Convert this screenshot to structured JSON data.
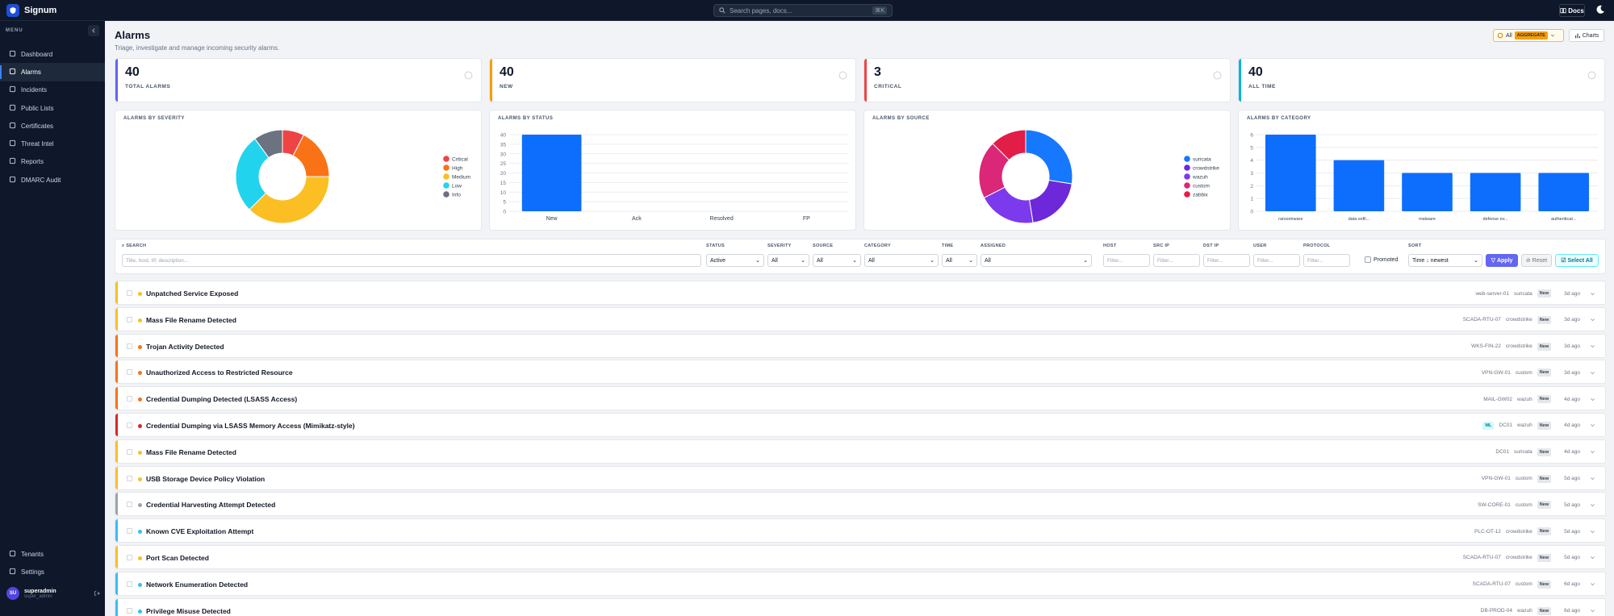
{
  "app": {
    "brand": "Signum",
    "search_placeholder": "Search pages, docs...",
    "search_kbd": "⌘K",
    "docs_label": "Docs"
  },
  "sidebar": {
    "menu_label": "MENU",
    "items": [
      {
        "label": "Dashboard",
        "icon": "dashboard-icon",
        "active": false
      },
      {
        "label": "Alarms",
        "icon": "alarm-icon",
        "active": true
      },
      {
        "label": "Incidents",
        "icon": "incident-icon",
        "active": false
      },
      {
        "label": "Public Lists",
        "icon": "list-icon",
        "active": false
      },
      {
        "label": "Certificates",
        "icon": "certificate-icon",
        "active": false
      },
      {
        "label": "Threat Intel",
        "icon": "threat-icon",
        "active": false
      },
      {
        "label": "Reports",
        "icon": "report-icon",
        "active": false
      },
      {
        "label": "DMARC Audit",
        "icon": "mail-icon",
        "active": false
      }
    ],
    "bottom_items": [
      {
        "label": "Tenants",
        "icon": "tenants-icon"
      },
      {
        "label": "Settings",
        "icon": "settings-icon"
      }
    ],
    "user": {
      "initials": "SU",
      "name": "superadmin",
      "role": "super_admin"
    }
  },
  "page": {
    "title": "Alarms",
    "subtitle": "Triage, investigate and manage incoming security alarms.",
    "agg_all": "All",
    "agg_badge": "AGGREGATE",
    "charts_label": "Charts"
  },
  "stats": [
    {
      "value": "40",
      "label": "TOTAL ALARMS",
      "color": "#6366f1"
    },
    {
      "value": "40",
      "label": "NEW",
      "color": "#f59e0b"
    },
    {
      "value": "3",
      "label": "CRITICAL",
      "color": "#ef4444"
    },
    {
      "value": "40",
      "label": "ALL TIME",
      "color": "#06b6d4"
    }
  ],
  "chart_data": [
    {
      "type": "pie",
      "title": "ALARMS BY SEVERITY",
      "labels": [
        "Critical",
        "High",
        "Medium",
        "Low",
        "Info"
      ],
      "values": [
        3,
        7,
        15,
        11,
        4
      ],
      "colors": [
        "#ef4444",
        "#f97316",
        "#fbbf24",
        "#22d3ee",
        "#6b7280"
      ],
      "donut": true,
      "legend": "right"
    },
    {
      "type": "bar",
      "title": "ALARMS BY STATUS",
      "categories": [
        "New",
        "Ack",
        "Resolved",
        "FP"
      ],
      "values": [
        40,
        0,
        0,
        0
      ],
      "ylim": [
        0,
        40
      ],
      "yticks": [
        0,
        5,
        10,
        15,
        20,
        25,
        30,
        35,
        40
      ],
      "color": "#0d6efd",
      "grid": true
    },
    {
      "type": "pie",
      "title": "ALARMS BY SOURCE",
      "labels": [
        "suricata",
        "crowdstrike",
        "wazuh",
        "custom",
        "zabbix"
      ],
      "values": [
        11,
        8,
        8,
        8,
        5
      ],
      "colors": [
        "#1677ff",
        "#6d28d9",
        "#7c3aed",
        "#db2777",
        "#e11d48"
      ],
      "donut": true,
      "legend": "right"
    },
    {
      "type": "bar",
      "title": "ALARMS BY CATEGORY",
      "categories": [
        "ransomware",
        "data exfil...",
        "malware",
        "defense ev...",
        "authenticat..."
      ],
      "values": [
        6,
        4,
        3,
        3,
        3
      ],
      "ylim": [
        0,
        6
      ],
      "yticks": [
        0,
        1,
        2,
        3,
        4,
        5,
        6
      ],
      "color": "#0d6efd",
      "grid": true
    }
  ],
  "filters": {
    "search_label": "SEARCH",
    "search_placeholder": "Title, host, IP, description...",
    "status_label": "STATUS",
    "status_value": "Active",
    "severity_label": "SEVERITY",
    "severity_value": "All",
    "source_label": "SOURCE",
    "source_value": "All",
    "category_label": "CATEGORY",
    "category_value": "All",
    "time_label": "TIME",
    "time_value": "All",
    "assigned_label": "ASSIGNED",
    "assigned_value": "All",
    "host_label": "HOST",
    "src_ip_label": "SRC IP",
    "dst_ip_label": "DST IP",
    "user_label": "USER",
    "protocol_label": "PROTOCOL",
    "filter_placeholder": "Filter...",
    "promoted_label": "Promoted",
    "sort_label": "SORT",
    "sort_value": "Time ↓ newest",
    "apply_label": "Apply",
    "reset_label": "Reset",
    "select_all_label": "Select All"
  },
  "severity_colors": {
    "critical": "#dc2626",
    "high": "#f97316",
    "medium": "#fbbf24",
    "low": "#38bdf8",
    "info": "#9ca3af"
  },
  "alarms": [
    {
      "title": "Unpatched Service Exposed",
      "severity": "medium",
      "host": "web-server-01",
      "source": "suricata",
      "status": "New",
      "age": "3d ago",
      "ml": false
    },
    {
      "title": "Mass File Rename Detected",
      "severity": "medium",
      "host": "SCADA-RTU-07",
      "source": "crowdstrike",
      "status": "New",
      "age": "3d ago",
      "ml": false
    },
    {
      "title": "Trojan Activity Detected",
      "severity": "high",
      "host": "WKS-FIN-22",
      "source": "crowdstrike",
      "status": "New",
      "age": "3d ago",
      "ml": false
    },
    {
      "title": "Unauthorized Access to Restricted Resource",
      "severity": "high",
      "host": "VPN-GW-01",
      "source": "custom",
      "status": "New",
      "age": "3d ago",
      "ml": false
    },
    {
      "title": "Credential Dumping Detected (LSASS Access)",
      "severity": "high",
      "host": "MAIL-GW02",
      "source": "wazuh",
      "status": "New",
      "age": "4d ago",
      "ml": false
    },
    {
      "title": "Credential Dumping via LSASS Memory Access (Mimikatz-style)",
      "severity": "critical",
      "host": "DC01",
      "source": "wazuh",
      "status": "New",
      "age": "4d ago",
      "ml": true,
      "ml_label": "ML"
    },
    {
      "title": "Mass File Rename Detected",
      "severity": "medium",
      "host": "DC01",
      "source": "suricata",
      "status": "New",
      "age": "4d ago",
      "ml": false
    },
    {
      "title": "USB Storage Device Policy Violation",
      "severity": "medium",
      "host": "VPN-GW-01",
      "source": "custom",
      "status": "New",
      "age": "5d ago",
      "ml": false
    },
    {
      "title": "Credential Harvesting Attempt Detected",
      "severity": "info",
      "host": "SW-CORE-01",
      "source": "custom",
      "status": "New",
      "age": "5d ago",
      "ml": false
    },
    {
      "title": "Known CVE Exploitation Attempt",
      "severity": "low",
      "host": "PLC-OT-12",
      "source": "crowdstrike",
      "status": "New",
      "age": "5d ago",
      "ml": false
    },
    {
      "title": "Port Scan Detected",
      "severity": "medium",
      "host": "SCADA-RTU-07",
      "source": "crowdstrike",
      "status": "New",
      "age": "5d ago",
      "ml": false
    },
    {
      "title": "Network Enumeration Detected",
      "severity": "low",
      "host": "SCADA-RTU-07",
      "source": "custom",
      "status": "New",
      "age": "6d ago",
      "ml": false
    },
    {
      "title": "Privilege Misuse Detected",
      "severity": "low",
      "host": "DB-PROD-04",
      "source": "wazuh",
      "status": "New",
      "age": "6d ago",
      "ml": false
    }
  ]
}
